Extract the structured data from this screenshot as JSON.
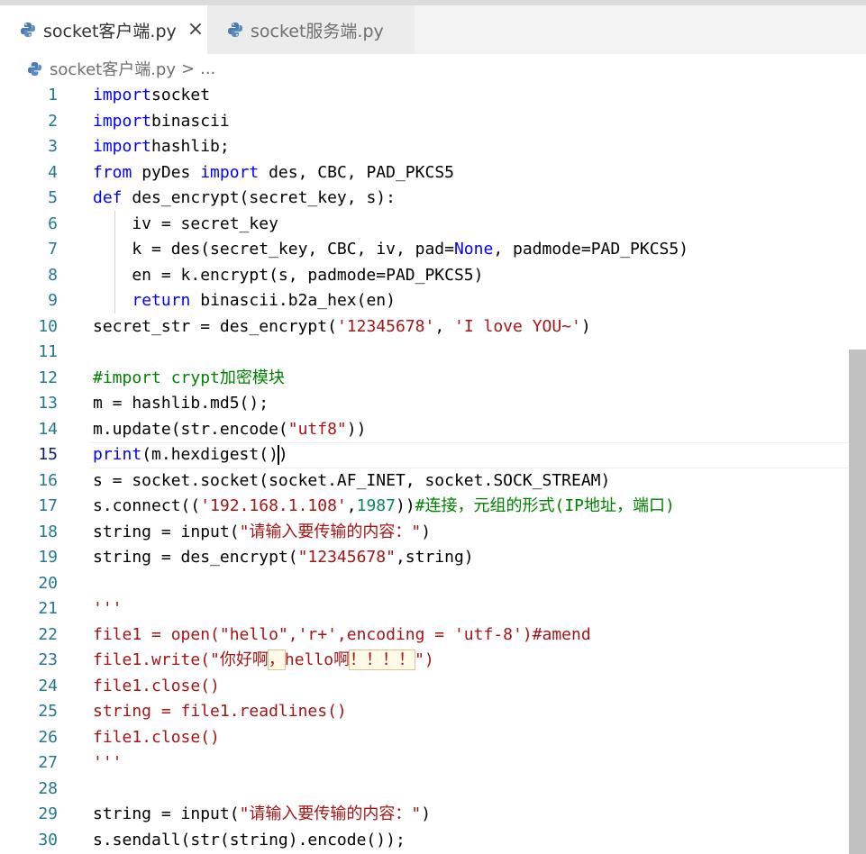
{
  "tabs": [
    {
      "label": "socket客户端.py",
      "active": true,
      "close": "×"
    },
    {
      "label": "socket服务端.py",
      "active": false
    }
  ],
  "breadcrumb": {
    "file": "socket客户端.py",
    "separator": ">",
    "more": "..."
  },
  "colors": {
    "keyword": "#0000ff",
    "string": "#a31515",
    "number": "#098658",
    "comment": "#008000",
    "lineNumber": "#237893"
  },
  "editor": {
    "current_line": 15,
    "lines": [
      {
        "n": "1",
        "tokens": [
          [
            "kw",
            "import"
          ],
          [
            "",
            "socket"
          ]
        ]
      },
      {
        "n": "2",
        "tokens": [
          [
            "kw",
            "import"
          ],
          [
            "",
            "binascii"
          ]
        ]
      },
      {
        "n": "3",
        "tokens": [
          [
            "kw",
            "import"
          ],
          [
            "",
            "hashlib;"
          ]
        ]
      },
      {
        "n": "4",
        "tokens": [
          [
            "kw",
            "from"
          ],
          [
            "",
            " pyDes "
          ],
          [
            "kw",
            "import"
          ],
          [
            "",
            " des, CBC, PAD_PKCS5"
          ]
        ]
      },
      {
        "n": "5",
        "tokens": [
          [
            "kw",
            "def"
          ],
          [
            "",
            " des_encrypt(secret_key, s):"
          ]
        ]
      },
      {
        "n": "6",
        "tokens": [
          [
            "",
            "    iv = secret_key"
          ]
        ]
      },
      {
        "n": "7",
        "tokens": [
          [
            "",
            "    k = des(secret_key, CBC, iv, pad="
          ],
          [
            "kw",
            "None"
          ],
          [
            "",
            ", padmode=PAD_PKCS5)"
          ]
        ]
      },
      {
        "n": "8",
        "tokens": [
          [
            "",
            "    en = k.encrypt(s, padmode=PAD_PKCS5)"
          ]
        ]
      },
      {
        "n": "9",
        "tokens": [
          [
            "",
            "    "
          ],
          [
            "kw",
            "return"
          ],
          [
            "",
            " binascii.b2a_hex(en)"
          ]
        ]
      },
      {
        "n": "10",
        "tokens": [
          [
            "",
            "secret_str = des_encrypt("
          ],
          [
            "str",
            "'12345678'"
          ],
          [
            "",
            ", "
          ],
          [
            "str",
            "'I love YOU~'"
          ],
          [
            "",
            ")"
          ]
        ]
      },
      {
        "n": "11",
        "tokens": []
      },
      {
        "n": "12",
        "tokens": [
          [
            "cm",
            "#import crypt加密模块"
          ]
        ]
      },
      {
        "n": "13",
        "tokens": [
          [
            "",
            "m = hashlib.md5();"
          ]
        ]
      },
      {
        "n": "14",
        "tokens": [
          [
            "",
            "m.update(str.encode("
          ],
          [
            "str",
            "\"utf8\""
          ],
          [
            "",
            "))"
          ]
        ]
      },
      {
        "n": "15",
        "tokens": [
          [
            "kw",
            "print"
          ],
          [
            "",
            "(m.hexdigest()"
          ],
          [
            "cursor",
            ""
          ],
          [
            "",
            ")"
          ]
        ]
      },
      {
        "n": "16",
        "tokens": [
          [
            "",
            "s = socket.socket(socket.AF_INET, socket.SOCK_STREAM)"
          ]
        ]
      },
      {
        "n": "17",
        "tokens": [
          [
            "",
            "s.connect(("
          ],
          [
            "str",
            "'192.168.1.108'"
          ],
          [
            "",
            ","
          ],
          [
            "num",
            "1987"
          ],
          [
            "",
            "))"
          ],
          [
            "cm",
            "#连接，元组的形式(IP地址，端口)"
          ]
        ]
      },
      {
        "n": "18",
        "tokens": [
          [
            "",
            "string = input("
          ],
          [
            "str",
            "\"请输入要传输的内容：\""
          ],
          [
            "",
            ")"
          ]
        ]
      },
      {
        "n": "19",
        "tokens": [
          [
            "",
            "string = des_encrypt("
          ],
          [
            "str",
            "\"12345678\""
          ],
          [
            "",
            ",string)"
          ]
        ]
      },
      {
        "n": "20",
        "tokens": []
      },
      {
        "n": "21",
        "tokens": [
          [
            "str",
            "'''"
          ]
        ]
      },
      {
        "n": "22",
        "tokens": [
          [
            "str",
            "file1 = open(\"hello\",'r+',encoding = 'utf-8')#amend"
          ]
        ]
      },
      {
        "n": "23",
        "tokens": [
          [
            "str",
            "file1.write(\"你好啊"
          ],
          [
            "strhl",
            "，"
          ],
          [
            "str",
            "hello啊"
          ],
          [
            "strhl",
            "！！！！"
          ],
          [
            "str",
            "\")"
          ]
        ]
      },
      {
        "n": "24",
        "tokens": [
          [
            "str",
            "file1.close()"
          ]
        ]
      },
      {
        "n": "25",
        "tokens": [
          [
            "str",
            "string = file1.readlines()"
          ]
        ]
      },
      {
        "n": "26",
        "tokens": [
          [
            "str",
            "file1.close()"
          ]
        ]
      },
      {
        "n": "27",
        "tokens": [
          [
            "str",
            "'''"
          ]
        ]
      },
      {
        "n": "28",
        "tokens": []
      },
      {
        "n": "29",
        "tokens": [
          [
            "",
            "string = input("
          ],
          [
            "str",
            "\"请输入要传输的内容：\""
          ],
          [
            "",
            ")"
          ]
        ]
      },
      {
        "n": "30",
        "tokens": [
          [
            "",
            "s.sendall(str(string).encode());"
          ]
        ]
      }
    ]
  }
}
